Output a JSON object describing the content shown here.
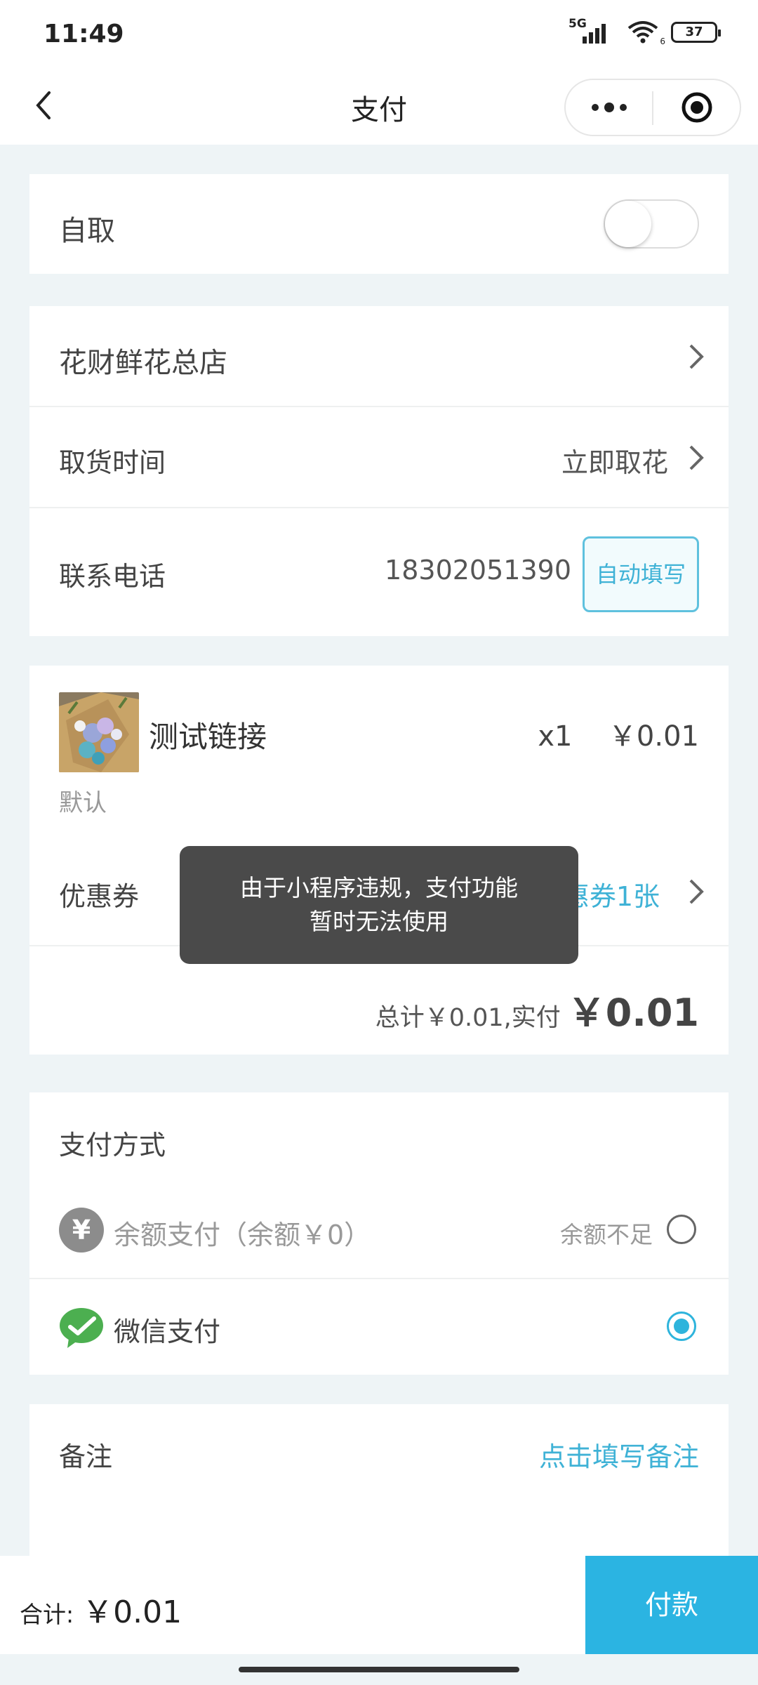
{
  "status_bar": {
    "time": "11:49",
    "network": "5G",
    "wifi_label": "6",
    "battery": "37"
  },
  "nav": {
    "title": "支付",
    "back_icon": "chevron-left-icon",
    "more_icon": "more-dots-icon",
    "close_icon": "target-circle-icon"
  },
  "pickup": {
    "label": "自取",
    "enabled": false
  },
  "store": {
    "name": "花财鲜花总店"
  },
  "pickup_time": {
    "label": "取货时间",
    "value": "立即取花"
  },
  "phone": {
    "label": "联系电话",
    "value": "18302051390",
    "auto_fill": "自动填写"
  },
  "product": {
    "name": "测试链接",
    "qty": "x1",
    "price": "￥0.01",
    "variant": "默认"
  },
  "coupon": {
    "label": "优惠券",
    "value": "惠券1张"
  },
  "total": {
    "summary": "总计￥0.01,实付",
    "actual": "￥0.01"
  },
  "toast": {
    "line1": "由于小程序违规，支付功能",
    "line2": "暂时无法使用"
  },
  "payment": {
    "title": "支付方式",
    "balance": {
      "label": "余额支付（余额￥0）",
      "status": "余额不足",
      "selected": false
    },
    "wechat": {
      "label": "微信支付",
      "selected": true
    }
  },
  "remark": {
    "label": "备注",
    "action": "点击填写备注"
  },
  "footer": {
    "total_label": "合计:",
    "total_value": "￥0.01",
    "pay_button": "付款"
  },
  "colors": {
    "accent": "#2bb4e2",
    "link": "#3fb2d6",
    "wechat_green": "#4caf50",
    "toast_bg": "#4a4a4a"
  }
}
